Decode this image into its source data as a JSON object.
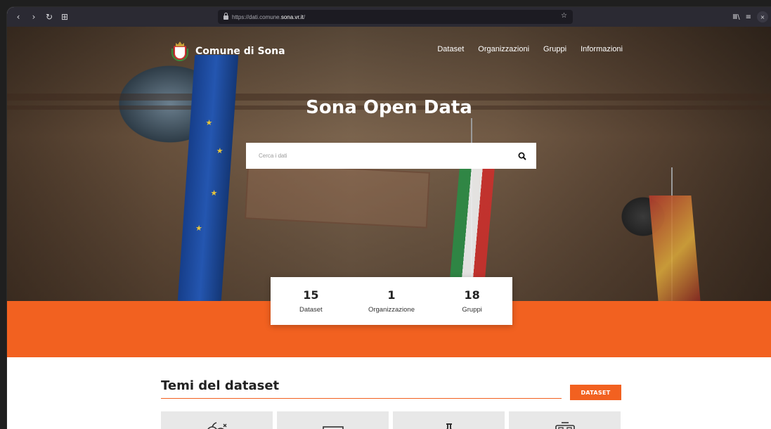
{
  "browser": {
    "url_prefix": "https://dati.comune.",
    "url_host": "sona.vr.it",
    "url_suffix": "/",
    "nav": {
      "back": "‹",
      "forward": "›",
      "reload": "↻",
      "new_tab": "⊞"
    },
    "bookmark_icon": "☆",
    "library_icon": "Ⅲ\\",
    "menu_icon": "≡",
    "close_icon": "×"
  },
  "site": {
    "brand": "Comune di Sona",
    "menu": [
      "Dataset",
      "Organizzazioni",
      "Gruppi",
      "Informazioni"
    ]
  },
  "hero": {
    "title": "Sona Open Data",
    "search_placeholder": "Cerca i dati"
  },
  "stats": [
    {
      "value": "15",
      "label": "Dataset"
    },
    {
      "value": "1",
      "label": "Organizzazione"
    },
    {
      "value": "18",
      "label": "Gruppi"
    }
  ],
  "themes": {
    "title": "Temi del dataset",
    "button": "DATASET"
  },
  "colors": {
    "accent": "#f26120",
    "toolbar": "#2b2a33"
  }
}
